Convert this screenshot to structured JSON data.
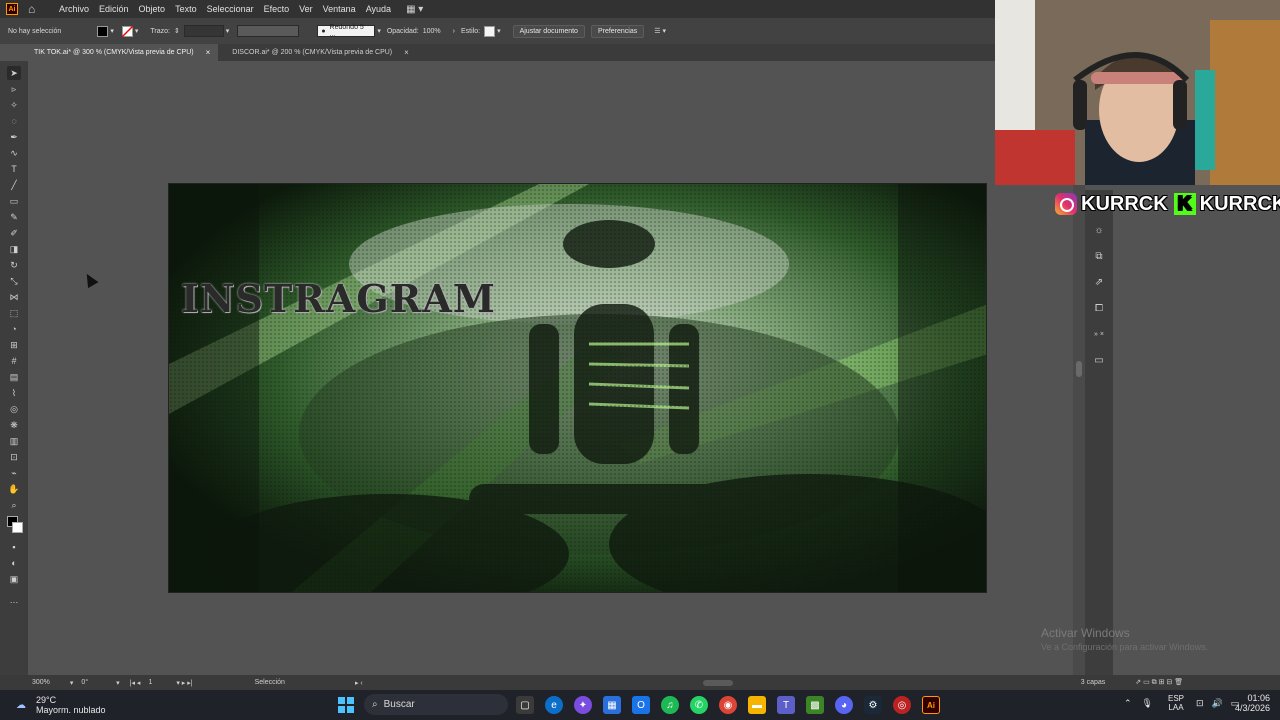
{
  "menubar": {
    "app_badge": "Ai",
    "items": [
      "Archivo",
      "Edición",
      "Objeto",
      "Texto",
      "Seleccionar",
      "Efecto",
      "Ver",
      "Ventana",
      "Ayuda"
    ]
  },
  "controlbar": {
    "selection": "No hay selección",
    "stroke_label": "Trazo:",
    "brush": "Redondo 5 ...",
    "opacity_label": "Opacidad:",
    "opacity_value": "100%",
    "style_label": "Estilo:",
    "adjust_doc": "Ajustar documento",
    "preferences": "Preferencias"
  },
  "tabs": [
    {
      "label": "TIK TOK.ai* @ 300 % (CMYK/Vista previa de CPU)",
      "active": true
    },
    {
      "label": "DISCOR.ai* @ 200 % (CMYK/Vista previa de CPU)",
      "active": false
    }
  ],
  "artboard": {
    "text": "INSTRAGRAM"
  },
  "social": {
    "instagram": "KURRCK",
    "kick": "KURRCK"
  },
  "watermark": {
    "title": "Activar Windows",
    "subtitle": "Ve a Configuración para activar Windows."
  },
  "statusbar": {
    "zoom": "300%",
    "rotation": "0°",
    "artboard_num": "1",
    "tool": "Selección",
    "layers": "3 capas"
  },
  "taskbar": {
    "weather_temp": "29°C",
    "weather_desc": "Mayorm. nublado",
    "search_placeholder": "Buscar",
    "lang1": "ESP",
    "lang2": "LAA",
    "time": "01:06",
    "date": "4/3/2026"
  },
  "colors": {
    "accent": "#ff9a00",
    "kick_green": "#53fc18",
    "canvas_bg": "#535353"
  }
}
